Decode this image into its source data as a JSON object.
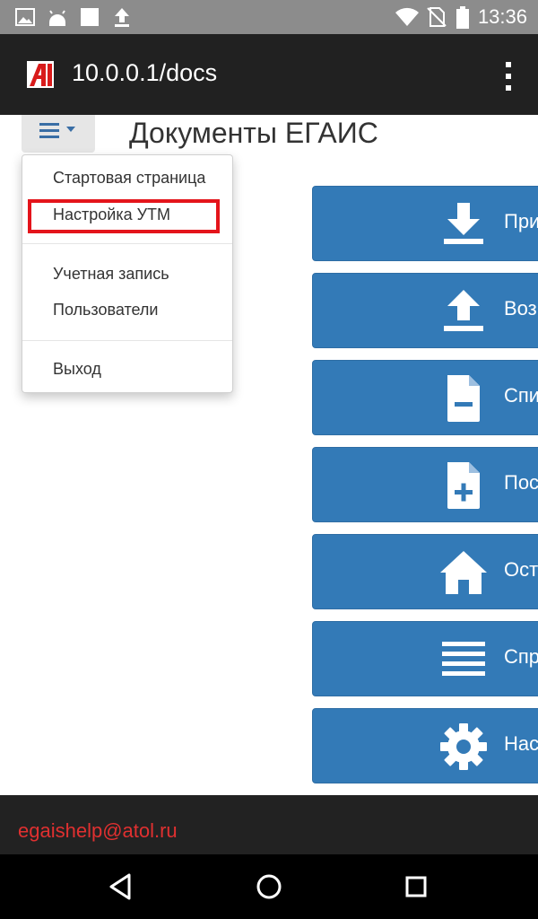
{
  "status_bar": {
    "time": "13:36",
    "icons": [
      "gallery-icon",
      "android-icon",
      "square-notification-icon",
      "upload-icon",
      "wifi-icon",
      "no-sim-icon",
      "battery-icon"
    ]
  },
  "app_bar": {
    "url": "10.0.0.1/docs",
    "logo": "app-logo-icon",
    "menu": "overflow-menu-icon"
  },
  "page": {
    "title": "Документы ЕГАИС",
    "menu_toggle": "hamburger-menu-icon"
  },
  "dropdown": {
    "items": [
      {
        "label": "Стартовая страница"
      },
      {
        "label": "Настройка УТМ"
      },
      {
        "label": "Учетная запись"
      },
      {
        "label": "Пользователи"
      },
      {
        "label": "Выход"
      }
    ],
    "highlight_color": "#e4141b"
  },
  "tiles": [
    {
      "label": "При",
      "icon": "download-icon"
    },
    {
      "label": "Воз",
      "icon": "upload-icon"
    },
    {
      "label": "Спи",
      "icon": "document-minus-icon"
    },
    {
      "label": "Пос",
      "icon": "document-plus-icon"
    },
    {
      "label": "Ост",
      "icon": "home-icon"
    },
    {
      "label": "Спр",
      "icon": "list-icon"
    },
    {
      "label": "Нас",
      "icon": "gear-icon"
    }
  ],
  "footer": {
    "email": "egaishelp@atol.ru"
  },
  "nav_bar": {
    "buttons": [
      "back-icon",
      "home-circle-icon",
      "recents-icon"
    ]
  },
  "colors": {
    "tile_blue": "#337ab7",
    "app_bar": "#212121",
    "status_bar": "#8c8c8c",
    "footer_email": "#e03030"
  }
}
